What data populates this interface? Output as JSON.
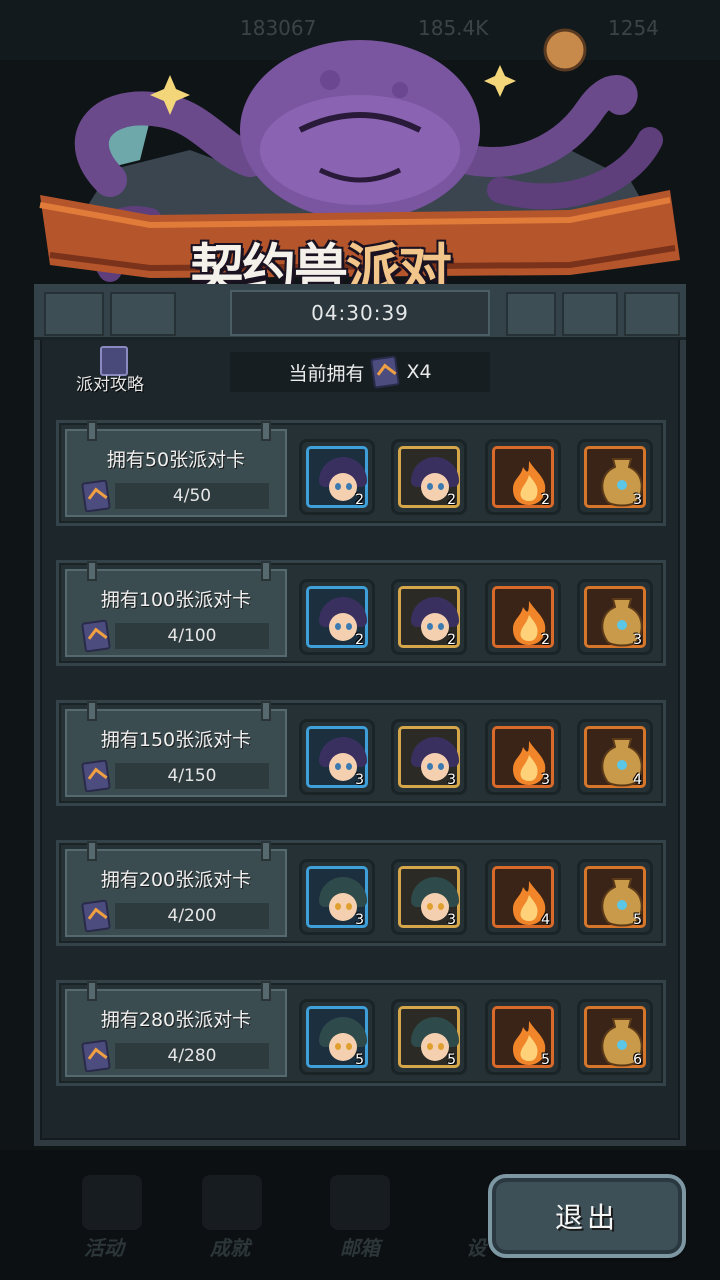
{
  "background": {
    "resources": [
      "183067",
      "185.4K",
      "1254"
    ],
    "tabs": [
      "活动",
      "成就",
      "邮箱",
      "设"
    ]
  },
  "header": {
    "title_part1": "契约兽",
    "title_part2": "派对",
    "timer": "04:30:39"
  },
  "guide": {
    "label": "派对攻略",
    "icon": "book-icon"
  },
  "owned": {
    "label": "当前拥有",
    "count": "X4",
    "icon": "party-card-icon"
  },
  "milestones": [
    {
      "title": "拥有50张派对卡",
      "progress": "4/50",
      "rewards": [
        {
          "type": "hero-blue",
          "count": "2"
        },
        {
          "type": "hero-gold",
          "count": "2"
        },
        {
          "type": "flame",
          "count": "2"
        },
        {
          "type": "vase",
          "count": "3"
        }
      ]
    },
    {
      "title": "拥有100张派对卡",
      "progress": "4/100",
      "rewards": [
        {
          "type": "hero-blue",
          "count": "2"
        },
        {
          "type": "hero-gold",
          "count": "2"
        },
        {
          "type": "flame",
          "count": "2"
        },
        {
          "type": "vase",
          "count": "3"
        }
      ]
    },
    {
      "title": "拥有150张派对卡",
      "progress": "4/150",
      "rewards": [
        {
          "type": "hero-blue",
          "count": "3"
        },
        {
          "type": "hero-gold",
          "count": "3"
        },
        {
          "type": "flame",
          "count": "3"
        },
        {
          "type": "vase",
          "count": "4"
        }
      ]
    },
    {
      "title": "拥有200张派对卡",
      "progress": "4/200",
      "rewards": [
        {
          "type": "hero2-blue",
          "count": "3"
        },
        {
          "type": "hero2-gold",
          "count": "3"
        },
        {
          "type": "flame",
          "count": "4"
        },
        {
          "type": "vase",
          "count": "5"
        }
      ]
    },
    {
      "title": "拥有280张派对卡",
      "progress": "4/280",
      "rewards": [
        {
          "type": "hero2-blue",
          "count": "5"
        },
        {
          "type": "hero2-gold",
          "count": "5"
        },
        {
          "type": "flame",
          "count": "5"
        },
        {
          "type": "vase",
          "count": "6"
        }
      ]
    }
  ],
  "exit_button": "退出",
  "colors": {
    "panel": "#1d272b",
    "row": "#253135",
    "blue_frame": "#3f9fd8",
    "gold_frame": "#d6a64a",
    "orange_frame": "#d86a2a",
    "title_accent": "#f2c58a"
  }
}
